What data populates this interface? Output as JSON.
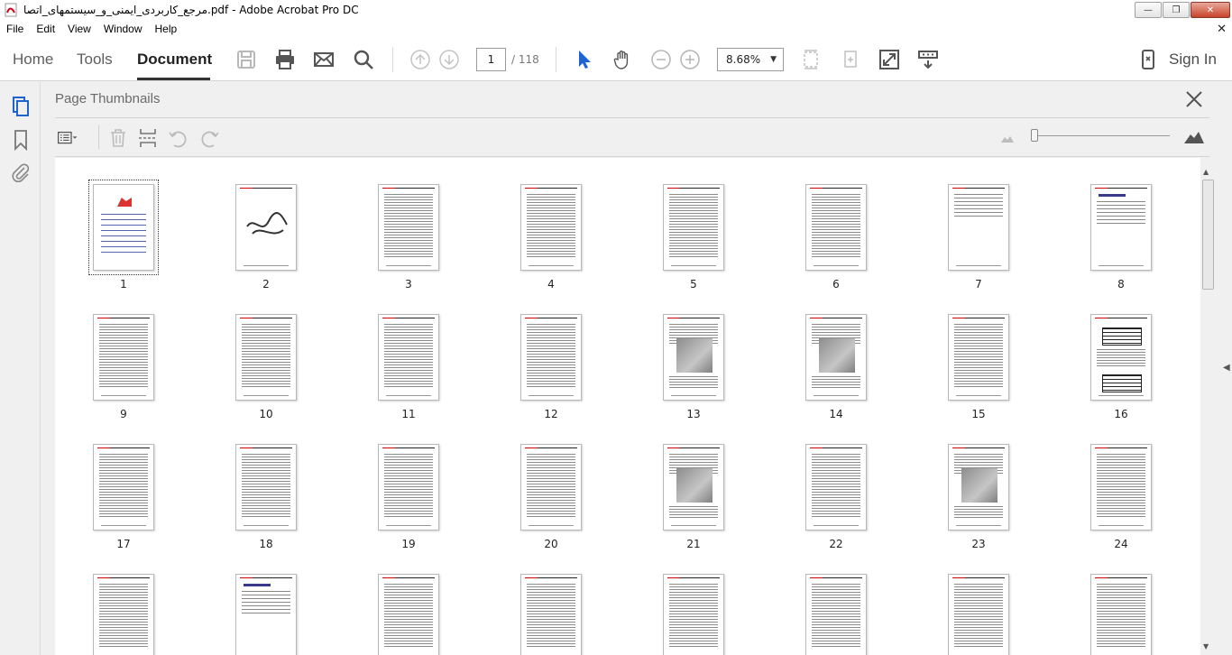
{
  "window": {
    "title": "مرجع_کاربردی_ایمنی_و_سیستمهای_اتصا.pdf - Adobe Acrobat Pro DC",
    "minimize": "—",
    "maximize": "❐",
    "close": "✕"
  },
  "menu": {
    "items": [
      "File",
      "Edit",
      "View",
      "Window",
      "Help"
    ],
    "close_glyph": "✕"
  },
  "toolbar": {
    "tabs": [
      {
        "label": "Home",
        "active": false
      },
      {
        "label": "Tools",
        "active": false
      },
      {
        "label": "Document",
        "active": true
      }
    ],
    "page_current": "1",
    "page_total": "/ 118",
    "zoom": "8.68%",
    "zoom_arrow": "▼",
    "sign_in": "Sign In"
  },
  "panel": {
    "title": "Page Thumbnails",
    "close_glyph": "✕"
  },
  "thumbnails": [
    {
      "n": "1",
      "kind": "cover"
    },
    {
      "n": "2",
      "kind": "callig"
    },
    {
      "n": "3",
      "kind": "text"
    },
    {
      "n": "4",
      "kind": "text"
    },
    {
      "n": "5",
      "kind": "text"
    },
    {
      "n": "6",
      "kind": "text"
    },
    {
      "n": "7",
      "kind": "sparse"
    },
    {
      "n": "8",
      "kind": "heading"
    },
    {
      "n": "9",
      "kind": "text"
    },
    {
      "n": "10",
      "kind": "text"
    },
    {
      "n": "11",
      "kind": "text"
    },
    {
      "n": "12",
      "kind": "text"
    },
    {
      "n": "13",
      "kind": "image"
    },
    {
      "n": "14",
      "kind": "image"
    },
    {
      "n": "15",
      "kind": "text"
    },
    {
      "n": "16",
      "kind": "table"
    },
    {
      "n": "17",
      "kind": "text"
    },
    {
      "n": "18",
      "kind": "text"
    },
    {
      "n": "19",
      "kind": "text"
    },
    {
      "n": "20",
      "kind": "text"
    },
    {
      "n": "21",
      "kind": "image"
    },
    {
      "n": "22",
      "kind": "text"
    },
    {
      "n": "23",
      "kind": "image"
    },
    {
      "n": "24",
      "kind": "text"
    },
    {
      "n": "",
      "kind": "text"
    },
    {
      "n": "",
      "kind": "heading"
    },
    {
      "n": "",
      "kind": "text"
    },
    {
      "n": "",
      "kind": "text"
    },
    {
      "n": "",
      "kind": "text"
    },
    {
      "n": "",
      "kind": "text"
    },
    {
      "n": "",
      "kind": "text"
    },
    {
      "n": "",
      "kind": "text"
    }
  ],
  "colors": {
    "accent_blue": "#1f63d1",
    "pdf_red": "#d0021b"
  }
}
